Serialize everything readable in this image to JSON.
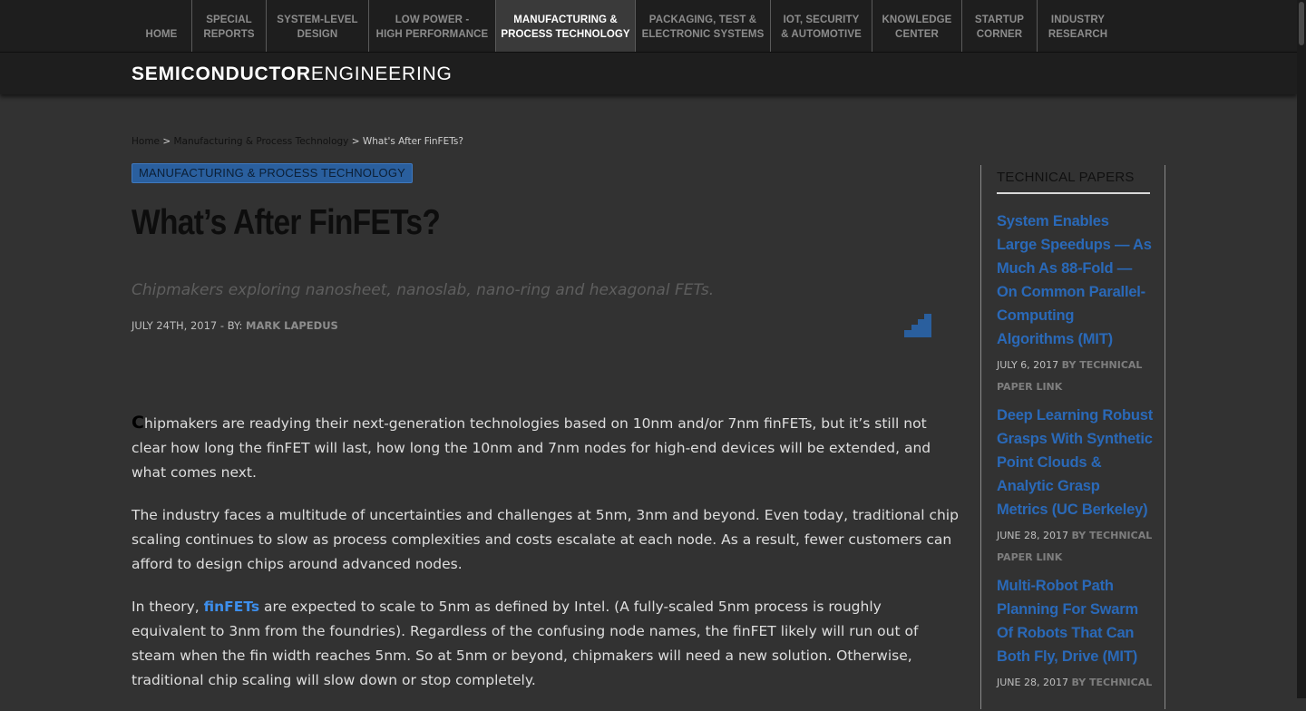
{
  "nav": {
    "items": [
      {
        "label": "HOME"
      },
      {
        "label": "SPECIAL\nREPORTS"
      },
      {
        "label": "SYSTEM-LEVEL\nDESIGN"
      },
      {
        "label": "LOW POWER -\nHIGH PERFORMANCE"
      },
      {
        "label": "MANUFACTURING &\nPROCESS TECHNOLOGY",
        "active": true
      },
      {
        "label": "PACKAGING, TEST &\nELECTRONIC SYSTEMS"
      },
      {
        "label": "IOT, SECURITY\n& AUTOMOTIVE"
      },
      {
        "label": "KNOWLEDGE\nCENTER"
      },
      {
        "label": "STARTUP\nCORNER"
      },
      {
        "label": "INDUSTRY\nRESEARCH"
      }
    ]
  },
  "brand": {
    "bold": "SEMICONDUCTOR",
    "light": "ENGINEERING"
  },
  "breadcrumb": {
    "home": "Home",
    "sep1": " > ",
    "section": "Manufacturing & Process Technology",
    "sep2": " > ",
    "current": "What's After FinFETs?"
  },
  "article": {
    "category": "MANUFACTURING & PROCESS TECHNOLOGY",
    "title": "What’s After FinFETs?",
    "subtitle": "Chipmakers exploring nanosheet, nanoslab, nano-ring and hexagonal FETs.",
    "date": "JULY 24TH, 2017 - BY: ",
    "author": "MARK LAPEDUS",
    "p1_dropcap": "C",
    "p1_rest": "hipmakers are readying their next-generation technologies based on 10nm and/or 7nm finFETs, but it’s still not clear how long the finFET will last, how long the 10nm and 7nm nodes for high-end devices will be extended, and what comes next.",
    "p2": "The industry faces a multitude of uncertainties and challenges at 5nm, 3nm and beyond. Even today, traditional chip scaling continues to slow as process complexities and costs escalate at each node. As a result, fewer customers can afford to design chips around advanced nodes.",
    "p3_pre": "In theory, ",
    "p3_link": "finFETs",
    "p3_post": " are expected to scale to 5nm as defined by Intel. (A fully-scaled 5nm process is roughly equivalent to 3nm from the foundries). Regardless of the confusing node names, the finFET likely will run out of steam when the fin width reaches 5nm. So at 5nm or beyond, chipmakers will need a new solution. Otherwise, traditional chip scaling will slow down or stop completely."
  },
  "sidebar": {
    "heading": "TECHNICAL PAPERS",
    "papers": [
      {
        "title": "System Enables Large Speedups — As Much As 88-Fold — On Common Parallel-Computing Algorithms (MIT)",
        "date": "JULY 6, 2017 ",
        "by": "BY TECHNICAL PAPER LINK"
      },
      {
        "title": "Deep Learning Robust Grasps With Synthetic Point Clouds & Analytic Grasp Metrics (UC Berkeley)",
        "date": "JUNE 28, 2017 ",
        "by": "BY TECHNICAL PAPER LINK"
      },
      {
        "title": "Multi-Robot Path Planning For Swarm Of Robots That Can Both Fly, Drive (MIT)",
        "date": "JUNE 28, 2017 ",
        "by": "BY TECHNICAL"
      }
    ]
  },
  "colors": {
    "accent": "#2a69b8",
    "link": "#3d8eeb",
    "badge": "#2a5f9e",
    "background": "#323232"
  },
  "icons": {
    "share": "stairs-icon"
  }
}
